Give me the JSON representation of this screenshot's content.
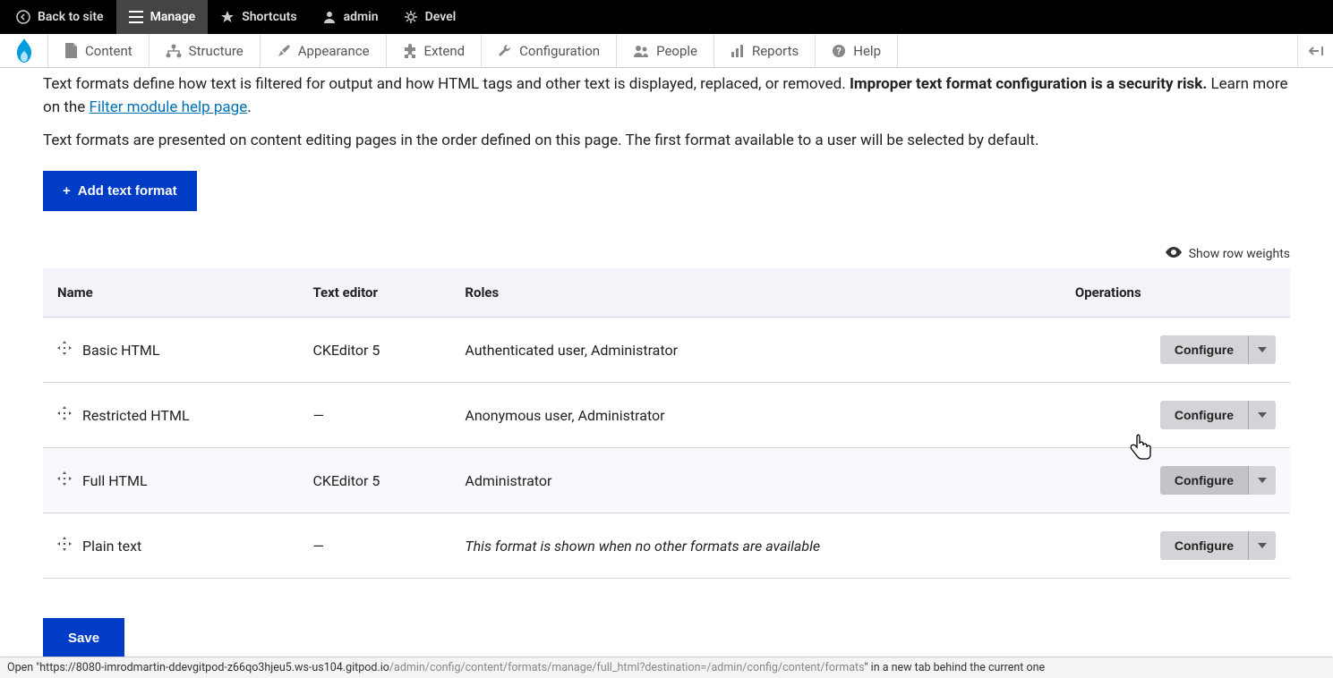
{
  "toolbar_top": {
    "back": "Back to site",
    "manage": "Manage",
    "shortcuts": "Shortcuts",
    "admin": "admin",
    "devel": "Devel"
  },
  "admin_menu": {
    "content": "Content",
    "structure": "Structure",
    "appearance": "Appearance",
    "extend": "Extend",
    "configuration": "Configuration",
    "people": "People",
    "reports": "Reports",
    "help": "Help"
  },
  "intro": {
    "part1": "Text formats define how text is filtered for output and how HTML tags and other text is displayed, replaced, or removed. ",
    "strong": "Improper text format configuration is a security risk.",
    "part2": " Learn more on the ",
    "link": "Filter module help page",
    "part3": "."
  },
  "second_para": "Text formats are presented on content editing pages in the order defined on this page. The first format available to a user will be selected by default.",
  "add_button": "Add text format",
  "show_weights": "Show row weights",
  "table": {
    "headers": {
      "name": "Name",
      "editor": "Text editor",
      "roles": "Roles",
      "ops": "Operations"
    },
    "rows": [
      {
        "name": "Basic HTML",
        "editor": "CKEditor 5",
        "roles": "Authenticated user, Administrator",
        "italic": false
      },
      {
        "name": "Restricted HTML",
        "editor": "—",
        "roles": "Anonymous user, Administrator",
        "italic": false
      },
      {
        "name": "Full HTML",
        "editor": "CKEditor 5",
        "roles": "Administrator",
        "italic": false
      },
      {
        "name": "Plain text",
        "editor": "—",
        "roles": "This format is shown when no other formats are available",
        "italic": true
      }
    ],
    "configure": "Configure"
  },
  "save": "Save",
  "status": {
    "pre": "Open \"",
    "host": "https://8080-imrodmartin-ddevgitpod-z66qo3hjeu5.ws-us104.gitpod.io",
    "path": "/admin/config/content/formats/manage/full_html?destination=/admin/config/content/formats",
    "post": "\" in a new tab behind the current one"
  }
}
